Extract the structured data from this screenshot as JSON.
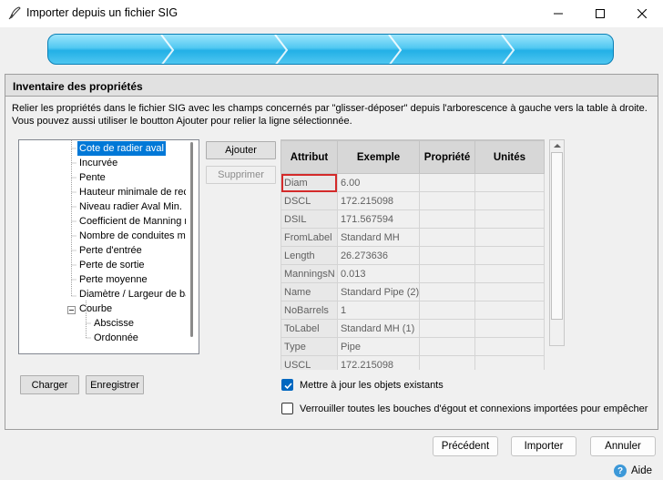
{
  "window": {
    "title": "Importer depuis un fichier SIG",
    "minimize_icon": "minimize-icon",
    "maximize_icon": "maximize-icon",
    "close_icon": "close-icon"
  },
  "panel": {
    "header": "Inventaire des propriétés",
    "description": "Relier les propriétés dans le fichier SIG avec les champs concernés par \"glisser-déposer\" depuis l'arborescence à gauche vers la table à droite. Vous pouvez aussi utiliser le boutton Ajouter pour relier la ligne sélectionnée."
  },
  "tree": {
    "items": [
      {
        "label": "Cote de radier aval",
        "selected": true
      },
      {
        "label": "Incurvée"
      },
      {
        "label": "Pente"
      },
      {
        "label": "Hauteur minimale de reco"
      },
      {
        "label": "Niveau radier Aval Min."
      },
      {
        "label": "Coefficient de Manning n"
      },
      {
        "label": "Nombre de conduites mul"
      },
      {
        "label": "Perte d'entrée"
      },
      {
        "label": "Perte de sortie"
      },
      {
        "label": "Perte moyenne"
      },
      {
        "label": "Diamètre / Largeur de ba"
      },
      {
        "label": "Courbe"
      },
      {
        "label": "Abscisse"
      },
      {
        "label": "Ordonnée"
      }
    ]
  },
  "buttons": {
    "add": "Ajouter",
    "remove": "Supprimer",
    "load": "Charger",
    "save": "Enregistrer",
    "previous": "Précédent",
    "import": "Importer",
    "cancel": "Annuler",
    "help": "Aide"
  },
  "grid": {
    "columns": [
      "Attribut",
      "Exemple",
      "Propriété",
      "Unités"
    ],
    "rows": [
      {
        "attribut": "Diam",
        "exemple": "6.00",
        "propriete": "",
        "unites": ""
      },
      {
        "attribut": "DSCL",
        "exemple": "172.215098",
        "propriete": "",
        "unites": ""
      },
      {
        "attribut": "DSIL",
        "exemple": "171.567594",
        "propriete": "",
        "unites": ""
      },
      {
        "attribut": "FromLabel",
        "exemple": "Standard MH",
        "propriete": "",
        "unites": ""
      },
      {
        "attribut": "Length",
        "exemple": "26.273636",
        "propriete": "",
        "unites": ""
      },
      {
        "attribut": "ManningsN",
        "exemple": "0.013",
        "propriete": "",
        "unites": ""
      },
      {
        "attribut": "Name",
        "exemple": "Standard Pipe (2)",
        "propriete": "",
        "unites": ""
      },
      {
        "attribut": "NoBarrels",
        "exemple": "1",
        "propriete": "",
        "unites": ""
      },
      {
        "attribut": "ToLabel",
        "exemple": "Standard MH (1)",
        "propriete": "",
        "unites": ""
      },
      {
        "attribut": "Type",
        "exemple": "Pipe",
        "propriete": "",
        "unites": ""
      },
      {
        "attribut": "USCL",
        "exemple": "172.215098",
        "propriete": "",
        "unites": ""
      }
    ]
  },
  "options": {
    "update_existing": {
      "label": "Mettre à jour les objets existants",
      "checked": true
    },
    "lock_all": {
      "label": "Verrouiller toutes les bouches d'égout et connexions importées pour empêcher",
      "checked": false
    }
  },
  "colors": {
    "accent": "#0078d7",
    "checkbox": "#0067c0",
    "selection_outline": "#d42a2a",
    "wizard_bar": "#22b0e6"
  }
}
